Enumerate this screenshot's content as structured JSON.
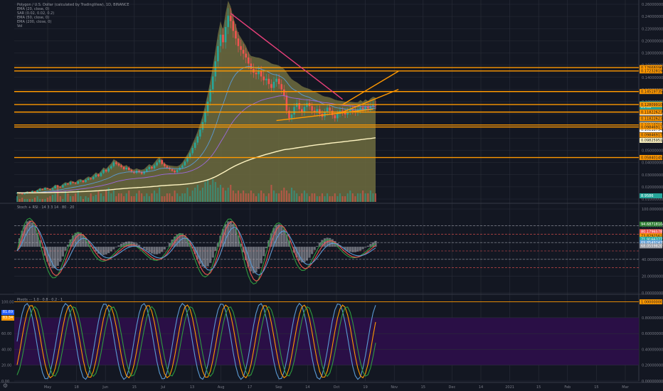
{
  "colors": {
    "background": "#131722",
    "grid": "#2a2e39",
    "up": "#26a69a",
    "down": "#ef5350",
    "orange": "#ff9800",
    "cream": "#fff5c2",
    "olive_fill": "#6f6c3e",
    "purple_fill": "#2a0f46",
    "pink": "#e8407a",
    "ema20": "#5b9bd5",
    "ema50": "#9c6ade"
  },
  "legend_main": [
    "Polygon / U.S. Dollar (calculated by TradingView), 1D, BINANCE",
    "EMA (20, close, 0)",
    "SAR (0.02, 0.02, 0.2)",
    "EMA (50, close, 0)",
    "EMA (200, close, 0)",
    "Vol"
  ],
  "legend_ind1": "Stoch + RSI · 14 3 3 14 · 80 · 20",
  "legend_ind2": "Pivots ··· 1.0 · 0.8 · 0.2 · 1",
  "pine_badges": [
    {
      "text": "81.69",
      "color": "#2962ff"
    },
    {
      "text": "83.34",
      "color": "#ff9800"
    }
  ],
  "chart_data": {
    "type": "candlestick",
    "title": "Polygon / U.S. Dollar (calculated by TradingView), 1D, BINANCE",
    "x_labels": [
      "May",
      "18",
      "Jun",
      "15",
      "Jul",
      "13",
      "Aug",
      "17",
      "Sep",
      "14",
      "Oct",
      "19",
      "Nov",
      "15",
      "Dec",
      "14",
      "2021",
      "15",
      "Feb",
      "15",
      "Mar"
    ],
    "price_axis": {
      "ylim": [
        0.0,
        0.26
      ],
      "ticks": [
        "0.26000000",
        "0.24000000",
        "0.22000000",
        "0.20000000",
        "0.18000000",
        "0.16000000",
        "0.14000000",
        "0.12000000",
        "0.10000000",
        "0.08000000",
        "0.07000000",
        "0.06000000",
        "0.05000000",
        "0.04000000",
        "0.03000000",
        "0.02000000",
        "0.01000000"
      ]
    },
    "close_series": [
      0.012,
      0.011,
      0.01,
      0.011,
      0.013,
      0.012,
      0.014,
      0.013,
      0.015,
      0.017,
      0.016,
      0.018,
      0.017,
      0.016,
      0.018,
      0.021,
      0.02,
      0.019,
      0.022,
      0.024,
      0.023,
      0.026,
      0.025,
      0.024,
      0.027,
      0.028,
      0.026,
      0.029,
      0.031,
      0.03,
      0.033,
      0.036,
      0.034,
      0.038,
      0.042,
      0.04,
      0.044,
      0.047,
      0.052,
      0.05,
      0.048,
      0.046,
      0.043,
      0.045,
      0.042,
      0.04,
      0.038,
      0.041,
      0.039,
      0.037,
      0.04,
      0.043,
      0.046,
      0.044,
      0.048,
      0.052,
      0.055,
      0.05,
      0.047,
      0.045,
      0.043,
      0.041,
      0.039,
      0.042,
      0.045,
      0.048,
      0.053,
      0.058,
      0.064,
      0.071,
      0.078,
      0.086,
      0.095,
      0.105,
      0.118,
      0.132,
      0.148,
      0.165,
      0.185,
      0.205,
      0.22,
      0.21,
      0.23,
      0.245,
      0.238,
      0.225,
      0.215,
      0.205,
      0.2,
      0.195,
      0.19,
      0.182,
      0.175,
      0.17,
      0.168,
      0.172,
      0.165,
      0.16,
      0.162,
      0.155,
      0.15,
      0.158,
      0.162,
      0.155,
      0.148,
      0.14,
      0.12,
      0.11,
      0.115,
      0.125,
      0.13,
      0.122,
      0.118,
      0.125,
      0.13,
      0.126,
      0.12,
      0.118,
      0.122,
      0.116,
      0.112,
      0.118,
      0.124,
      0.12,
      0.114,
      0.11,
      0.116,
      0.12,
      0.118,
      0.115,
      0.119,
      0.122,
      0.12,
      0.118,
      0.121,
      0.124,
      0.122,
      0.125,
      0.123,
      0.126,
      0.128,
      0.127
    ],
    "volume_series": [
      0.2,
      0.1,
      0.15,
      0.1,
      0.1,
      0.1,
      0.1,
      0.15,
      0.2,
      0.1,
      0.1,
      0.1,
      0.15,
      0.2,
      0.25,
      0.3,
      0.6,
      0.2,
      0.1,
      0.4,
      0.3,
      0.2,
      0.2,
      0.3,
      0.4,
      0.2,
      0.1,
      0.2,
      0.15,
      0.3,
      0.2,
      0.25,
      0.4,
      0.3,
      0.2,
      0.4,
      0.5,
      0.3,
      0.4,
      0.2,
      0.3,
      0.3,
      0.2,
      0.3,
      0.4,
      0.2,
      0.2,
      0.3,
      0.4,
      0.3,
      0.2,
      0.3,
      0.2,
      0.3,
      0.4,
      0.3,
      0.5,
      0.2,
      0.2,
      0.3,
      0.3,
      0.2,
      0.4,
      0.3,
      0.2,
      0.3,
      0.3,
      0.5,
      0.2,
      0.4,
      0.5,
      0.6,
      0.4,
      0.5,
      0.7,
      0.8,
      0.6,
      0.8,
      0.7,
      0.5,
      0.6,
      0.5,
      0.4,
      0.5,
      0.6,
      0.4,
      0.3,
      0.4,
      0.3,
      0.4,
      0.3,
      0.3,
      0.4,
      0.3,
      0.2,
      0.3,
      0.4,
      0.3,
      0.2,
      0.3,
      0.6,
      0.4,
      0.3,
      0.3,
      0.4,
      0.5,
      0.4,
      0.3,
      0.5,
      0.4,
      0.3,
      0.2,
      0.3,
      0.4,
      0.3,
      0.2,
      0.3,
      0.3,
      0.2,
      0.2,
      0.3,
      0.2,
      0.3,
      0.2,
      0.2,
      0.3,
      0.2,
      0.3,
      0.2,
      0.2,
      0.3,
      0.4,
      0.3,
      0.2,
      0.3,
      0.3,
      0.4,
      0.3,
      0.3,
      0.4,
      0.3,
      0.3
    ],
    "horizontal_levels": [
      {
        "label": "0.17668096",
        "value": 0.1767
      },
      {
        "label": "0.17232819",
        "value": 0.1723
      },
      {
        "label": "0.14519735",
        "value": 0.1452
      },
      {
        "label": "0.12809910",
        "value": 0.1281
      },
      {
        "label": "0.11822623",
        "value": 0.1182
      },
      {
        "label": "0.10118794",
        "value": 0.1012
      },
      {
        "label": "0.09846917",
        "value": 0.0985
      },
      {
        "label": "0.05840145",
        "value": 0.0584
      }
    ],
    "price_tags": [
      {
        "label": "0.12728546",
        "value": 0.129,
        "bg": "#26a69a"
      },
      {
        "label": "23:08",
        "value": 0.125,
        "bg": "#26a69a"
      },
      {
        "label": "0.12809910",
        "value": 0.117,
        "bg": "#ffffff"
      },
      {
        "label": "0.11822623",
        "value": 0.1095,
        "bg": "#ff9800"
      },
      {
        "label": "0.11561082",
        "value": 0.1025,
        "bg": "#5b9bd5"
      },
      {
        "label": "0.10118794",
        "value": 0.095,
        "bg": "#ffffff"
      },
      {
        "label": "0.09846917",
        "value": 0.088,
        "bg": "#ff9800"
      },
      {
        "label": "0.09825951",
        "value": 0.081,
        "bg": "#fff5c2"
      },
      {
        "label": "0.05840145",
        "value": 0.0584,
        "bg": "#ff9800"
      },
      {
        "label": "8.9586",
        "value": 0.008,
        "bg": "#26a69a"
      }
    ],
    "ind1_axis": {
      "ylim": [
        0,
        100
      ],
      "ticks": [
        "100.00000000",
        "80.00000000",
        "60.00000000",
        "40.00000000",
        "20.00000000",
        "0.00000000"
      ]
    },
    "ind1_tags": [
      {
        "label": "94.68718104",
        "value": 82,
        "bg": "#2e7d32"
      },
      {
        "label": "80.17965787",
        "value": 73,
        "bg": "#ef5350"
      },
      {
        "label": "73.82925612",
        "value": 68,
        "bg": "#ff9800"
      },
      {
        "label": "71.91663773",
        "value": 64,
        "bg": "#26a69a"
      },
      {
        "label": "69.85492435",
        "value": 60,
        "bg": "#5b9bd5"
      },
      {
        "label": "68.05598205",
        "value": 56,
        "bg": "#9598a1"
      }
    ],
    "ind2_axis": {
      "ylim": [
        0,
        1.05
      ],
      "ticks": [
        "1.00000000",
        "0.80000000",
        "0.60000000",
        "0.40000000",
        "0.20000000",
        "0.00000000"
      ]
    },
    "ind2_tags": [
      {
        "label": "1.00000000",
        "value": 1.0,
        "bg": "#ff9800"
      }
    ],
    "ind2_left_ticks": [
      "100.00",
      "80.00",
      "60.00",
      "40.00",
      "20.00",
      "0.00"
    ]
  }
}
